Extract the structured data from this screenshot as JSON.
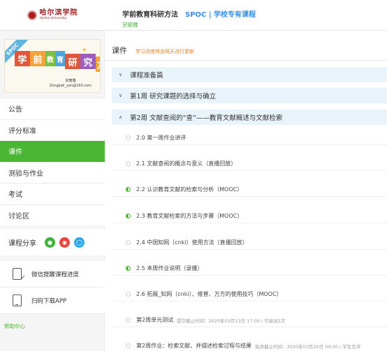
{
  "header": {
    "logo_cn": "哈尔滨学院",
    "logo_en": "Harbin University",
    "course_title": "学前教育科研方法",
    "course_tag": "SPOC | 学校专有课程",
    "teacher": "宗丽雅"
  },
  "sidebar": {
    "cover": {
      "ribbon": "SPOC",
      "blocks": [
        "学",
        "前",
        "教",
        "育",
        "研",
        "究",
        "方",
        "法"
      ],
      "teacher_name": "宗丽雅",
      "teacher_email": "Zongjiali_yan@163.com"
    },
    "menu": [
      {
        "label": "公告",
        "active": false
      },
      {
        "label": "评分标准",
        "active": false
      },
      {
        "label": "课件",
        "active": true
      },
      {
        "label": "测验与作业",
        "active": false
      },
      {
        "label": "考试",
        "active": false
      },
      {
        "label": "讨论区",
        "active": false
      }
    ],
    "share_label": "课程分享",
    "tools": [
      {
        "label": "微信提醒课程进度",
        "icon": "checklist-icon"
      },
      {
        "label": "扫码下载APP",
        "icon": "phone-icon"
      }
    ],
    "help": "帮助中心"
  },
  "main": {
    "title": "课件",
    "note": "学习进度将会隔天进行更新",
    "chapters": [
      {
        "label": "课程准备篇",
        "expanded": false
      },
      {
        "label": "第1周 研究课题的选择与确立",
        "expanded": false
      },
      {
        "label": "第2周 文献查阅的“查”——教育文献概述与文献检索",
        "expanded": true
      }
    ],
    "lessons": [
      {
        "label": "2.0 第一周作业讲评",
        "status": "empty",
        "sub": ""
      },
      {
        "label": "2.1 文献查阅的概念与意义（直播回放）",
        "status": "empty",
        "sub": ""
      },
      {
        "label": "2.2 认识教育文献的检索与分析（MOOC）",
        "status": "half",
        "sub": ""
      },
      {
        "label": "2.3 教育文献检索的方法与步骤（MOOC）",
        "status": "half",
        "sub": ""
      },
      {
        "label": "2.4 中国知网（cnki）使用方法（直播回放）",
        "status": "empty",
        "sub": ""
      },
      {
        "label": "2.5 本周作业说明（录播）",
        "status": "half",
        "sub": ""
      },
      {
        "label": "2.6 拓展_知网（cnki）、维普、万方的使用技巧（MOOC）",
        "status": "empty",
        "sub": ""
      },
      {
        "label": "第2周单元测试",
        "status": "empty",
        "sub": "提交截止时间：2020年03月13日 17:00 / 可尝试2次"
      },
      {
        "label": "第2周作业：检索文献，并描述检索过程与结果",
        "status": "empty",
        "sub": "批改截止时间：2020年03月20日 00:00 / 学生互评"
      }
    ]
  }
}
